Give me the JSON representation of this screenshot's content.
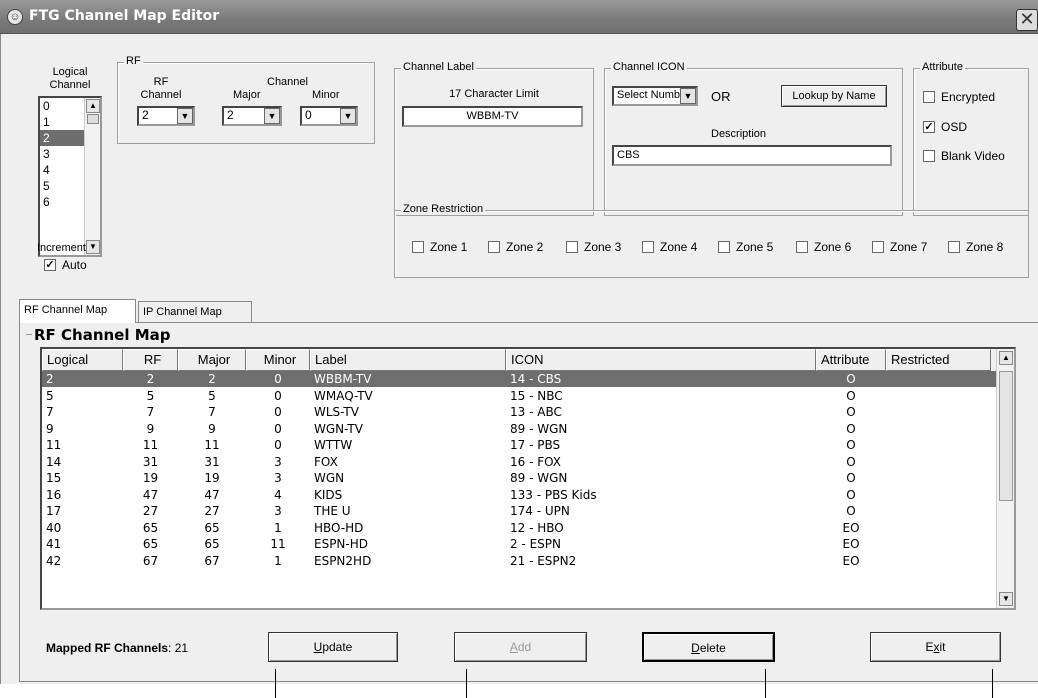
{
  "window": {
    "title": "FTG Channel Map Editor",
    "close_glyph": "✕"
  },
  "logical": {
    "label_line1": "Logical",
    "label_line2": "Channel",
    "items": [
      "0",
      "1",
      "2",
      "3",
      "4",
      "5",
      "6"
    ],
    "selected": "2",
    "increment_label": "Increment",
    "auto_label": "Auto",
    "auto_checked": true
  },
  "rf": {
    "legend": "RF",
    "rf_label_line1": "RF",
    "rf_label_line2": "Channel",
    "rf_value": "2",
    "channel_label": "Channel",
    "major_label": "Major",
    "major_value": "2",
    "minor_label": "Minor",
    "minor_value": "0"
  },
  "channel_label": {
    "legend": "Channel Label",
    "limit_text": "17 Character Limit",
    "value": "WBBM-TV"
  },
  "channel_icon": {
    "legend": "Channel ICON",
    "select_value": "Select Number",
    "or_text": "OR",
    "lookup_label": "Lookup by Name",
    "description_label": "Description",
    "description_value": "CBS"
  },
  "attribute": {
    "legend": "Attribute",
    "encrypted_label": "Encrypted",
    "encrypted": false,
    "osd_label": "OSD",
    "osd": true,
    "blank_label": "Blank Video",
    "blank": false
  },
  "zones": {
    "legend": "Zone Restriction",
    "items": [
      "Zone 1",
      "Zone 2",
      "Zone 3",
      "Zone 4",
      "Zone 5",
      "Zone 6",
      "Zone 7",
      "Zone 8"
    ]
  },
  "tabs": [
    "RF Channel Map",
    "IP Channel Map"
  ],
  "map": {
    "legend": "RF Channel Map",
    "columns": [
      "Logical",
      "RF",
      "Major",
      "Minor",
      "Label",
      "ICON",
      "Attribute",
      "Restricted"
    ],
    "rows": [
      [
        "2",
        "2",
        "2",
        "0",
        "WBBM-TV",
        "14 - CBS",
        "O",
        ""
      ],
      [
        "5",
        "5",
        "5",
        "0",
        "WMAQ-TV",
        "15 - NBC",
        "O",
        ""
      ],
      [
        "7",
        "7",
        "7",
        "0",
        "WLS-TV",
        "13 - ABC",
        "O",
        ""
      ],
      [
        "9",
        "9",
        "9",
        "0",
        "WGN-TV",
        "89 - WGN",
        "O",
        ""
      ],
      [
        "11",
        "11",
        "11",
        "0",
        "WTTW",
        "17 - PBS",
        "O",
        ""
      ],
      [
        "14",
        "31",
        "31",
        "3",
        "FOX",
        "16 - FOX",
        "O",
        ""
      ],
      [
        "15",
        "19",
        "19",
        "3",
        "WGN",
        "89 - WGN",
        "O",
        ""
      ],
      [
        "16",
        "47",
        "47",
        "4",
        "KIDS",
        "133 - PBS Kids",
        "O",
        ""
      ],
      [
        "17",
        "27",
        "27",
        "3",
        "THE U",
        "174 - UPN",
        "O",
        ""
      ],
      [
        "40",
        "65",
        "65",
        "1",
        "HBO-HD",
        "12 - HBO",
        "EO",
        ""
      ],
      [
        "41",
        "65",
        "65",
        "11",
        "ESPN-HD",
        "2 - ESPN",
        "EO",
        ""
      ],
      [
        "42",
        "67",
        "67",
        "1",
        "ESPN2HD",
        "21 - ESPN2",
        "EO",
        ""
      ]
    ],
    "mapped_label": "Mapped RF Channels",
    "mapped_colon": ": ",
    "mapped_count": "21"
  },
  "buttons": {
    "update_mnemonic": "U",
    "update_rest": "pdate",
    "add_mnemonic": "A",
    "add_rest": "dd",
    "delete_mnemonic": "D",
    "delete_rest": "elete",
    "exit_pre": "E",
    "exit_mnemonic": "x",
    "exit_rest": "it"
  }
}
